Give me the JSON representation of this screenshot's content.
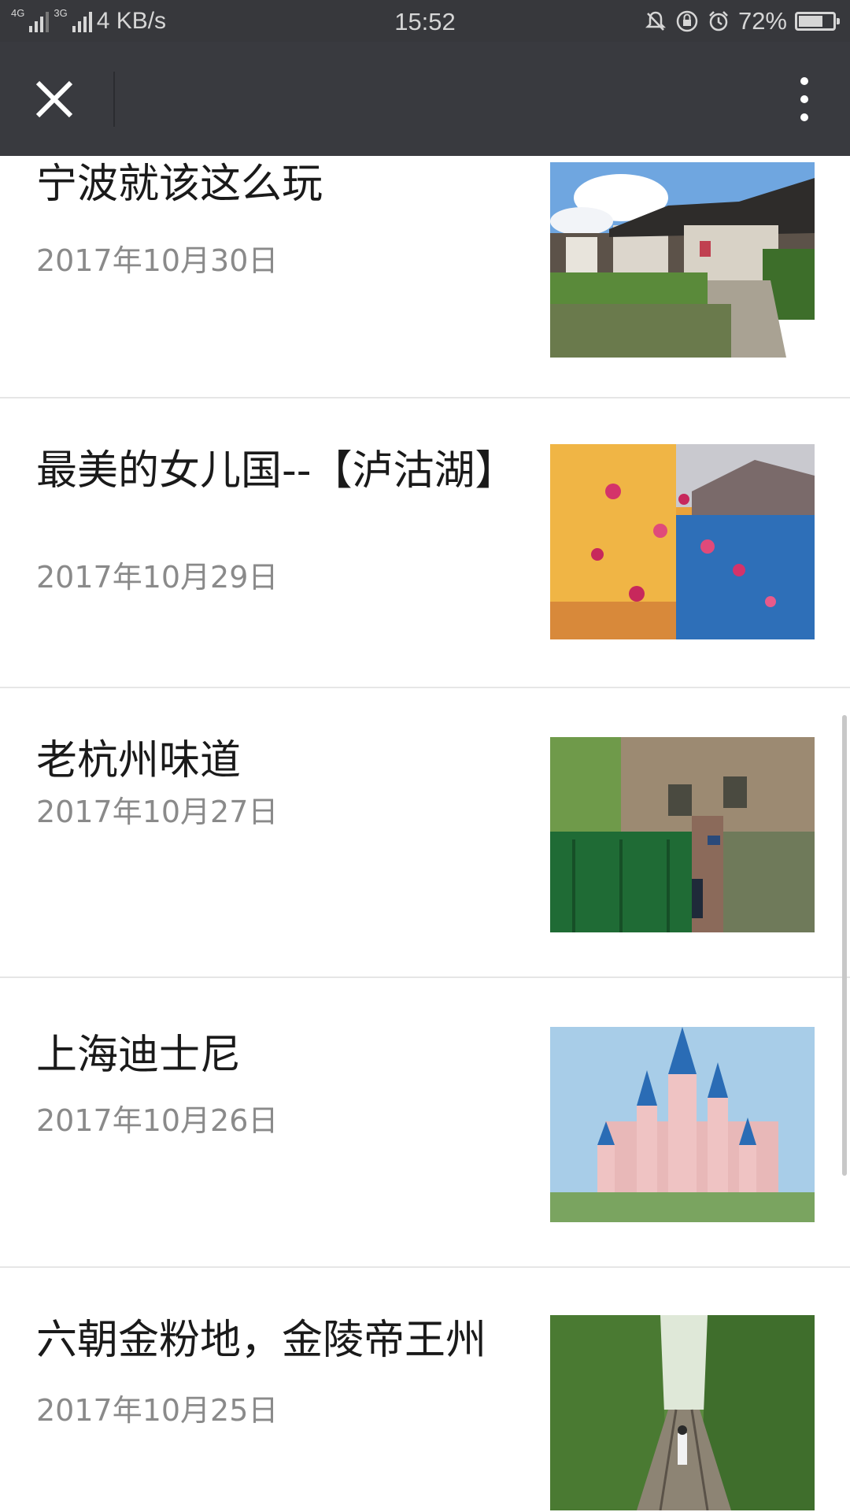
{
  "status_bar": {
    "network_1": "4G",
    "network_2": "4G",
    "network_3": "3G",
    "speed": "4 KB/s",
    "time": "15:52",
    "battery": "72%",
    "battery_level": 0.72
  },
  "toolbar": {
    "close_icon": "close-icon",
    "more_icon": "more-vertical-icon"
  },
  "articles": [
    {
      "title": "宁波就该这么玩",
      "date": "2017年10月30日",
      "thumb": "water-village-photo"
    },
    {
      "title": "最美的女儿国--【泸沽湖】",
      "date": "2017年10月29日",
      "thumb": "flowers-lake-photo"
    },
    {
      "title": "老杭州味道",
      "date": "2017年10月27日",
      "thumb": "ivy-building-photo"
    },
    {
      "title": "上海迪士尼",
      "date": "2017年10月26日",
      "thumb": "castle-photo"
    },
    {
      "title": "六朝金粉地，金陵帝王州",
      "date": "2017年10月25日",
      "thumb": "railway-forest-photo"
    }
  ]
}
